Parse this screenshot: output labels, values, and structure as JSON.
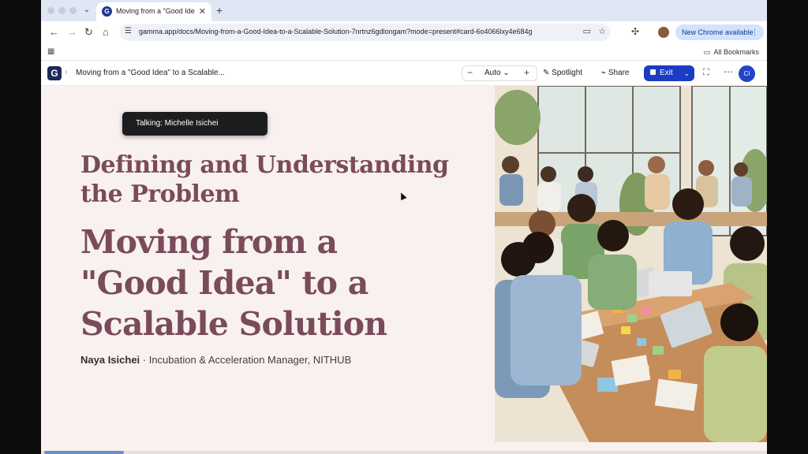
{
  "browser": {
    "tab": {
      "title": "Moving from a \"Good Idea\" to a Scalable Solution",
      "favicon_letter": "G"
    },
    "address": {
      "url": "gamma.app/docs/Moving-from-a-Good-Idea-to-a-Scalable-Solution-7nrtnz6gdlongam?mode=present#card-6o4066lxy4e684g"
    },
    "new_chrome_label": "New Chrome available",
    "all_bookmarks_label": "All Bookmarks"
  },
  "gamma": {
    "logo_letter": "G",
    "doc_title": "Moving from a \"Good Idea\" to a Scalable...",
    "zoom_value": "Auto",
    "spotlight_label": "Spotlight",
    "share_label": "Share",
    "exit_label": "Exit",
    "avatar_initials": "CI"
  },
  "slide": {
    "talking_label": "Talking: Michelle Isichei",
    "heading1": "Defining and Understanding the Problem",
    "heading2": "Moving from a \"Good Idea\" to a Scalable Solution",
    "presenter_name": "Naya Isichei",
    "presenter_separator": " · ",
    "presenter_role": "Incubation & Acceleration Manager, NITHUB",
    "progress_fraction": 0.11
  },
  "colors": {
    "heading": "#7a4b5a",
    "slide_bg": "#f8f1ef",
    "exit_button": "#1a3cc2",
    "progress": "#6d8fc9"
  },
  "icons": [
    "back-icon",
    "forward-icon",
    "reload-icon",
    "home-icon",
    "site-info-icon",
    "install-icon",
    "star-icon",
    "extensions-icon",
    "apps-grid-icon",
    "folder-icon",
    "spotlight-icon",
    "share-icon",
    "fullscreen-icon",
    "more-icon"
  ]
}
